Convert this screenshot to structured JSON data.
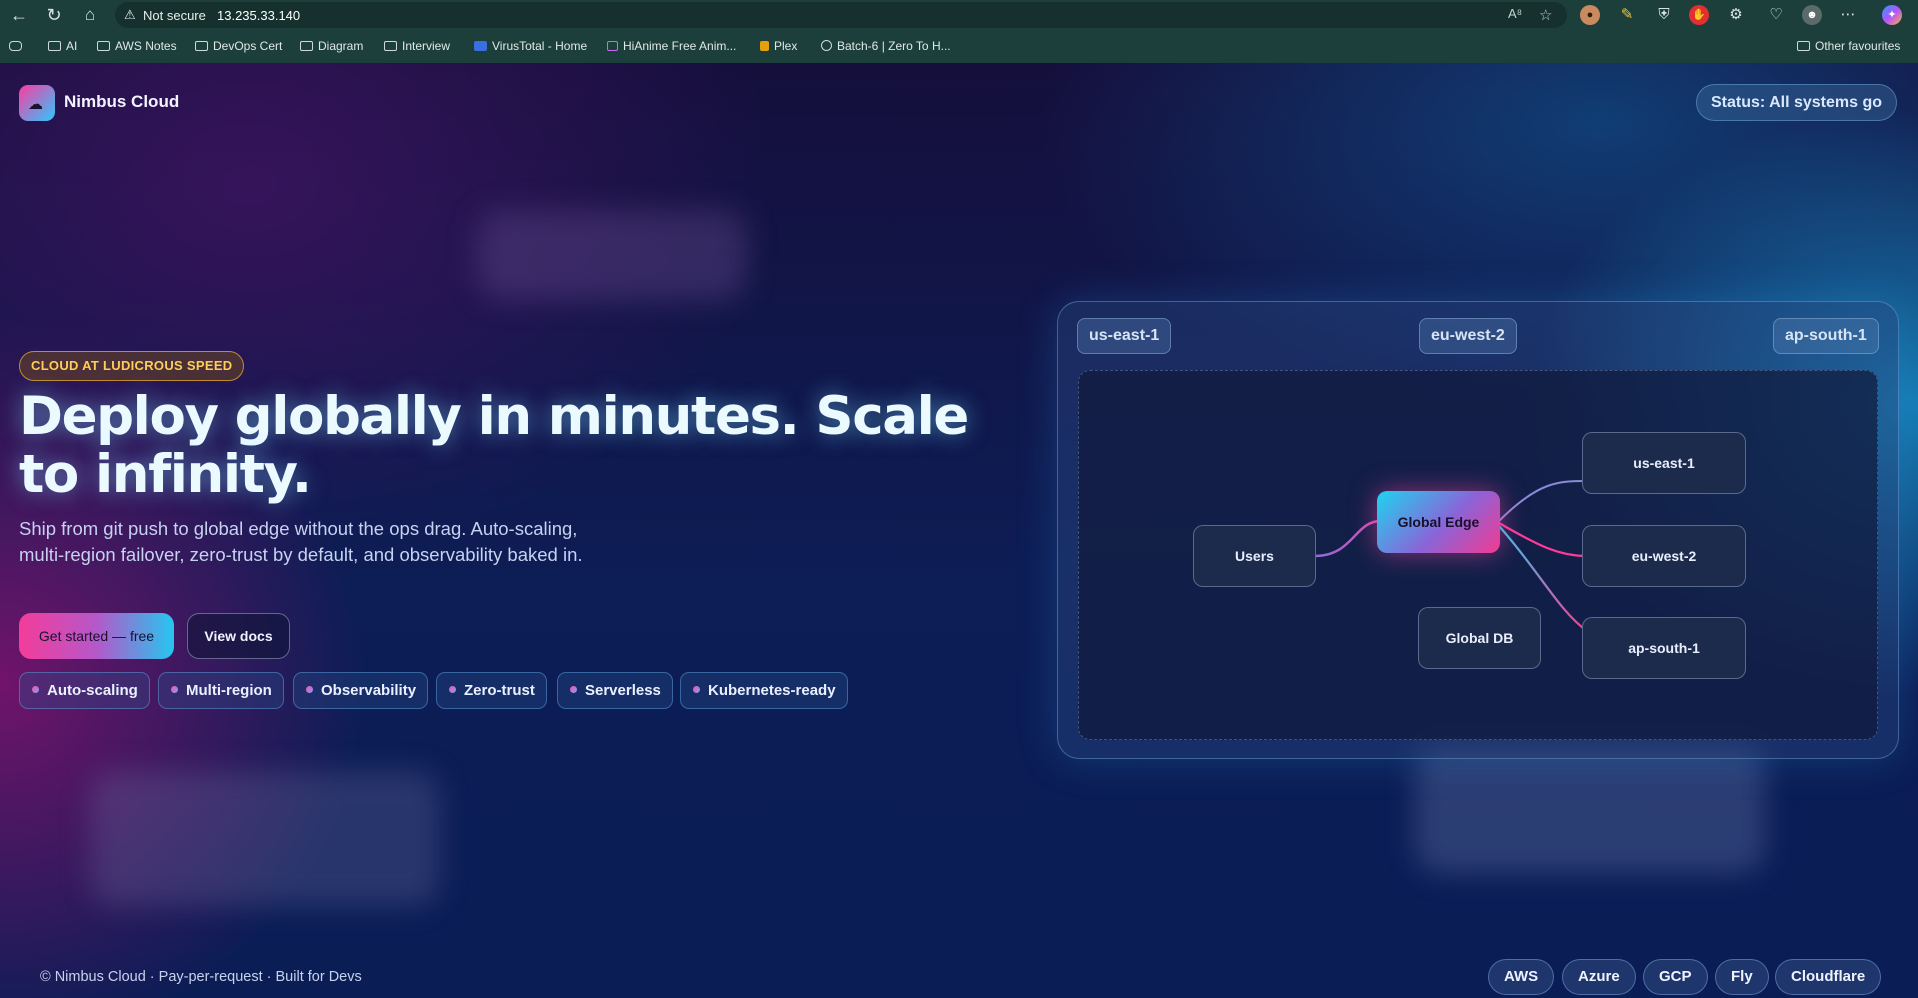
{
  "browser": {
    "security_label": "Not secure",
    "url": "13.235.33.140",
    "bookmarks": [
      "AI",
      "AWS Notes",
      "DevOps Cert",
      "Diagram",
      "Interview",
      "VirusTotal - Home",
      "HiAnime Free Anim...",
      "Plex",
      "Batch-6 | Zero To H..."
    ],
    "other_favourites": "Other favourites"
  },
  "header": {
    "brand": "Nimbus Cloud",
    "status": "Status: All systems go"
  },
  "hero": {
    "eyebrow": "CLOUD AT LUDICROUS SPEED",
    "headline": "Deploy globally in minutes. Scale to infinity.",
    "subtitle": "Ship from git push to global edge without the ops drag. Auto-scaling, multi-region failover, zero-trust by default, and observability baked in.",
    "primary_cta": "Get started — free",
    "secondary_cta": "View docs",
    "features": [
      "Auto-scaling",
      "Multi-region",
      "Observability",
      "Zero-trust",
      "Serverless",
      "Kubernetes-ready"
    ]
  },
  "diagram": {
    "regions": [
      "us-east-1",
      "eu-west-2",
      "ap-south-1"
    ],
    "nodes": {
      "users": "Users",
      "edge": "Global Edge",
      "db": "Global DB",
      "us_east": "us-east-1",
      "eu_west": "eu-west-2",
      "ap_south": "ap-south-1"
    }
  },
  "footer": {
    "text": "© Nimbus Cloud · Pay-per-request · Built for Devs",
    "providers": [
      "AWS",
      "Azure",
      "GCP",
      "Fly",
      "Cloudflare"
    ]
  },
  "colors": {
    "accent_pink": "#f43c9a",
    "accent_cyan": "#25c6f0",
    "eyebrow_gold": "#ffcd5a"
  }
}
